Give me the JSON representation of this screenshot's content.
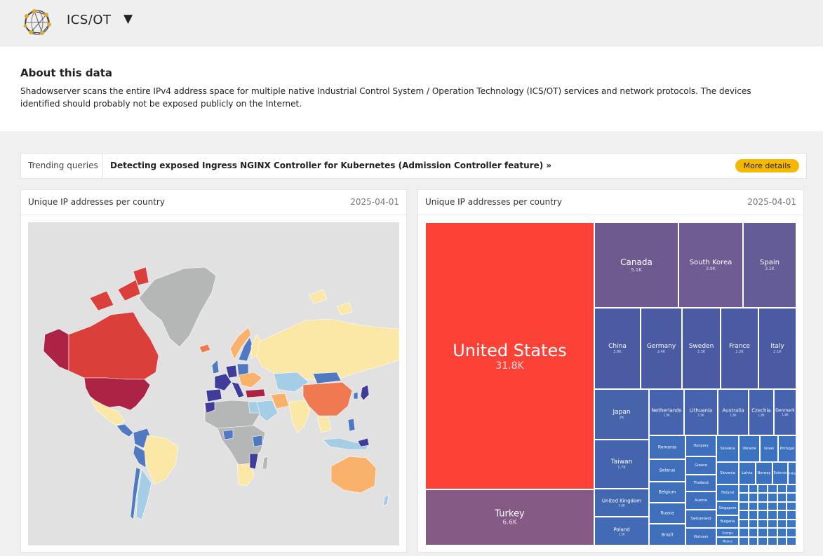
{
  "header": {
    "title": "ICS/OT",
    "dropdown_glyph": "▼"
  },
  "about": {
    "heading": "About this data",
    "text": "Shadowserver scans the entire IPv4 address space for multiple native Industrial Control System / Operation Technology (ICS/OT) services and network protocols. The devices identified should probably not be exposed publicly on the Internet."
  },
  "trending": {
    "label": "Trending queries",
    "link": "Detecting exposed Ingress NGINX Controller for Kubernetes (Admission Controller feature) »",
    "button": "More details"
  },
  "map_panel": {
    "title": "Unique IP addresses per country",
    "date": "2025-04-01"
  },
  "treemap_panel": {
    "title": "Unique IP addresses per country",
    "date": "2025-04-01"
  },
  "colors": {
    "accent": "#f5b800",
    "map_background": "#e1e1e1",
    "no_data": "#b5b6b6",
    "scale": [
      "#3f3d99",
      "#4f7ac2",
      "#a6cde6",
      "#fbe7a6",
      "#f9b26c",
      "#ef7a52",
      "#db3f3a",
      "#ad2345"
    ]
  },
  "treemap": [
    {
      "name": "United States",
      "value": "31.8K",
      "color": "#fc4236"
    },
    {
      "name": "Turkey",
      "value": "6.6K",
      "color": "#855a85"
    },
    {
      "name": "Canada",
      "value": "5.1K",
      "color": "#6e5a8e"
    },
    {
      "name": "South Korea",
      "value": "3.9K",
      "color": "#6f5c93"
    },
    {
      "name": "Spain",
      "value": "3.1K",
      "color": "#645c95"
    },
    {
      "name": "China",
      "value": "2.8K",
      "color": "#4a5ba3"
    },
    {
      "name": "Germany",
      "value": "2.4K",
      "color": "#4a5ba3"
    },
    {
      "name": "Sweden",
      "value": "2.3K",
      "color": "#4a5ba3"
    },
    {
      "name": "France",
      "value": "2.2K",
      "color": "#4a5ba3"
    },
    {
      "name": "Italy",
      "value": "2.1K",
      "color": "#4a5ba3"
    },
    {
      "name": "Japan",
      "value": "2K",
      "color": "#4763aa"
    },
    {
      "name": "Netherlands",
      "value": "1.9K",
      "color": "#4664ad"
    },
    {
      "name": "Lithuania",
      "value": "1.9K",
      "color": "#4664ad"
    },
    {
      "name": "Australia",
      "value": "1.8K",
      "color": "#4664ad"
    },
    {
      "name": "Czechia",
      "value": "1.8K",
      "color": "#4664ad"
    },
    {
      "name": "Denmark",
      "value": "1.8K",
      "color": "#4664ad"
    },
    {
      "name": "Taiwan",
      "value": "1.7K",
      "color": "#4465ae"
    },
    {
      "name": "United Kingdom",
      "value": "1.6K",
      "color": "#4268b2"
    },
    {
      "name": "Poland",
      "value": "1.5K",
      "color": "#426ab5"
    },
    {
      "name": "Romania",
      "value": "",
      "color": "#3f6ebb"
    },
    {
      "name": "Belarus",
      "value": "",
      "color": "#3f6ebb"
    },
    {
      "name": "Belgium",
      "value": "",
      "color": "#3f6ebb"
    },
    {
      "name": "Russia",
      "value": "",
      "color": "#3f6ebb"
    },
    {
      "name": "Brazil",
      "value": "",
      "color": "#3f6ebb"
    },
    {
      "name": "Hungary",
      "value": "",
      "color": "#3e70bd"
    },
    {
      "name": "Greece",
      "value": "",
      "color": "#3e70bd"
    },
    {
      "name": "Thailand",
      "value": "",
      "color": "#3e70bd"
    },
    {
      "name": "Austria",
      "value": "",
      "color": "#3e70bd"
    },
    {
      "name": "Switzerland",
      "value": "",
      "color": "#3e70bd"
    },
    {
      "name": "Vietnam",
      "value": "",
      "color": "#3e70bd"
    },
    {
      "name": "Slovakia",
      "value": "",
      "color": "#3c72c0"
    },
    {
      "name": "Ukraine",
      "value": "",
      "color": "#3c72c0"
    },
    {
      "name": "Israel",
      "value": "",
      "color": "#3c72c0"
    },
    {
      "name": "Portugal",
      "value": "",
      "color": "#3c72c0"
    },
    {
      "name": "Slovenia",
      "value": "",
      "color": "#3c72c0"
    },
    {
      "name": "Latvia",
      "value": "",
      "color": "#3c72c0"
    },
    {
      "name": "Norway",
      "value": "",
      "color": "#3c72c0"
    },
    {
      "name": "Estonia",
      "value": "",
      "color": "#3c72c0"
    },
    {
      "name": "India",
      "value": "",
      "color": "#3c72c0"
    },
    {
      "name": "Finland",
      "value": "",
      "color": "#3b74c2"
    },
    {
      "name": "Singapore",
      "value": "",
      "color": "#3b74c2"
    },
    {
      "name": "Bulgaria",
      "value": "",
      "color": "#3b74c2"
    },
    {
      "name": "Georgia",
      "value": "",
      "color": "#3b74c2"
    },
    {
      "name": "Mexico",
      "value": "",
      "color": "#3b74c2"
    }
  ]
}
